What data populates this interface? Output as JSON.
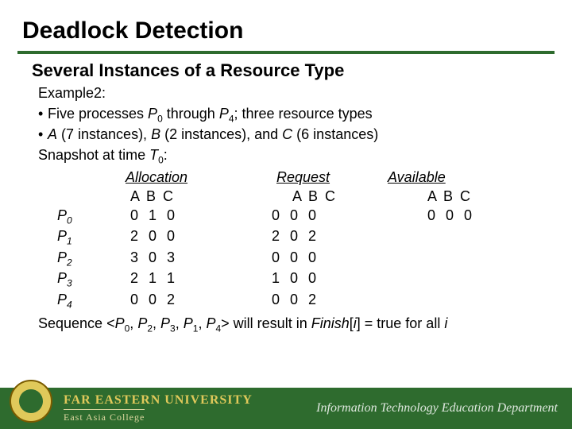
{
  "title": "Deadlock Detection",
  "subtitle": "Several Instances of a Resource Type",
  "example_label": "Example2:",
  "bullet1_pre": "Five processes ",
  "bullet1_p0": "P",
  "bullet1_p0s": "0",
  "bullet1_mid": " through ",
  "bullet1_p4": "P",
  "bullet1_p4s": "4",
  "bullet1_post": "; three resource types",
  "bullet2_a": "A",
  "bullet2_atxt": " (7 instances), ",
  "bullet2_b": "B",
  "bullet2_btxt": " (2 instances), and ",
  "bullet2_c": "C",
  "bullet2_ctxt": " (6 instances)",
  "snapshot_pre": "Snapshot at time ",
  "snapshot_T": "T",
  "snapshot_Tsub": "0",
  "snapshot_post": ":",
  "hdr_alloc": "Allocation",
  "hdr_req": "Request",
  "hdr_avail": "Available",
  "abc": "A B C",
  "rows": [
    {
      "p": "P",
      "ps": "0",
      "alloc": "0 1 0",
      "req": "0 0 0",
      "avail": "0 0 0"
    },
    {
      "p": "P",
      "ps": "1",
      "alloc": "2 0 0",
      "req": "2 0 2",
      "avail": ""
    },
    {
      "p": "P",
      "ps": "2",
      "alloc": "3 0 3",
      "req": "0 0 0",
      "avail": ""
    },
    {
      "p": "P",
      "ps": "3",
      "alloc": "2 1 1",
      "req": "1 0 0",
      "avail": ""
    },
    {
      "p": "P",
      "ps": "4",
      "alloc": "0 0 2",
      "req": "0 0 2",
      "avail": ""
    }
  ],
  "seq_pre": "Sequence <",
  "seq_items": [
    {
      "p": "P",
      "s": "0"
    },
    {
      "p": "P",
      "s": "2"
    },
    {
      "p": "P",
      "s": "3"
    },
    {
      "p": "P",
      "s": "1"
    },
    {
      "p": "P",
      "s": "4"
    }
  ],
  "seq_sep": ", ",
  "seq_mid": "> will result in ",
  "seq_finish": "Finish",
  "seq_br_open": "[",
  "seq_i": "i",
  "seq_br_close": "]",
  "seq_post": " = true for all ",
  "seq_i2": "i",
  "footer": {
    "uni": "FAR EASTERN UNIVERSITY",
    "college": "East Asia College",
    "dept": "Information Technology Education Department"
  }
}
